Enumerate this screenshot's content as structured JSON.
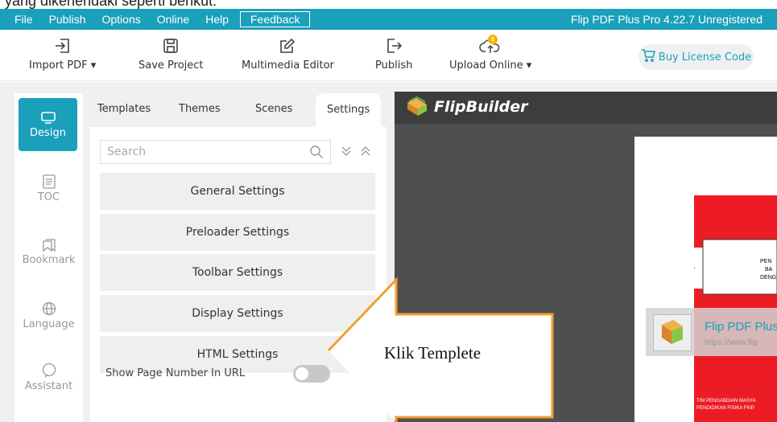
{
  "caption": "yang dikehendaki seperti berikut:",
  "menu": {
    "items": [
      "File",
      "Publish",
      "Options",
      "Online",
      "Help"
    ],
    "feedback": "Feedback",
    "app_title": "Flip PDF Plus Pro 4.22.7 Unregistered"
  },
  "toolbar": {
    "import": "Import PDF ▾",
    "save": "Save Project",
    "multimedia": "Multimedia Editor",
    "publish": "Publish",
    "upload": "Upload Online ▾",
    "upload_badge": "$",
    "buy": "Buy License Code"
  },
  "rail": {
    "design": "Design",
    "toc": "TOC",
    "bookmark": "Bookmark",
    "language": "Language",
    "assistant": "Assistant"
  },
  "tabs": {
    "templates": "Templates",
    "themes": "Themes",
    "scenes": "Scenes",
    "settings": "Settings"
  },
  "search": {
    "placeholder": "Search"
  },
  "settings_buttons": {
    "general": "General Settings",
    "preloader": "Preloader Settings",
    "toolbar": "Toolbar Settings",
    "display": "Display Settings",
    "html": "HTML Settings"
  },
  "show_page_number": {
    "label": "Show Page Number In URL",
    "enabled": false
  },
  "preview": {
    "brand": "FlipBuilder",
    "loading_title": "Flip PDF Plus",
    "loading_url": "https://www.flip",
    "banner_lines": [
      "PEN",
      "BA",
      "DENG"
    ],
    "bottom_lines": [
      "TIM PENGABDIAN MASYA",
      "PENDIDIKAN FISIKA FKIP"
    ]
  },
  "annotation": {
    "text": "Klik Templete"
  },
  "colors": {
    "accent": "#1aa0ba",
    "cover_red": "#ed1c24",
    "arrow_outline": "#f0a030"
  }
}
